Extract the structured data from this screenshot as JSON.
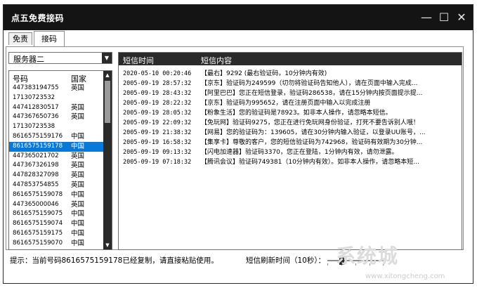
{
  "window": {
    "title": "点五免费接码"
  },
  "titlebar": {
    "minimize_glyph": "—",
    "maximize_glyph": "☐",
    "close_glyph": "✕"
  },
  "tabs": [
    {
      "label": "免责"
    },
    {
      "label": "接码"
    }
  ],
  "server_select": {
    "value": "服务器二"
  },
  "number_list": {
    "headers": {
      "number": "号码",
      "country": "国家"
    },
    "rows": [
      {
        "number": "447383194755",
        "country": "英国"
      },
      {
        "number": "17130723532",
        "country": ""
      },
      {
        "number": "447412830517",
        "country": "英国"
      },
      {
        "number": "447367650736",
        "country": "英国"
      },
      {
        "number": "17130723538",
        "country": ""
      },
      {
        "number": "8616575159176",
        "country": "中国"
      },
      {
        "number": "8616575159178",
        "country": "中国"
      },
      {
        "number": "447365021702",
        "country": "英国"
      },
      {
        "number": "447367326198",
        "country": "英国"
      },
      {
        "number": "447828327098",
        "country": "英国"
      },
      {
        "number": "447853754855",
        "country": "英国"
      },
      {
        "number": "8616575159078",
        "country": "中国"
      },
      {
        "number": "447365000046",
        "country": "英国"
      },
      {
        "number": "8616575159075",
        "country": "中国"
      },
      {
        "number": "8616575159074",
        "country": "中国"
      },
      {
        "number": "8616575159175",
        "country": "中国"
      },
      {
        "number": "8616575159070",
        "country": "中国"
      }
    ],
    "selected_index": 6
  },
  "sms_list": {
    "headers": {
      "time": "短信时间",
      "content": "短信内容"
    },
    "rows": [
      {
        "time": "2020-05-10 00:20:46",
        "content": "【最右】9292 (最右验证码，10分钟内有效)"
      },
      {
        "time": "2005-09-19 28:57:32",
        "content": "【京东】验证码为249599（切勿将验证码告知他人），请在页面中输入完成..."
      },
      {
        "time": "2005-09-19 28:43:32",
        "content": "【阿里巴巴】您正在短信登录，验证码286538，请在15分钟内按页面提示提..."
      },
      {
        "time": "2005-09-19 28:22:32",
        "content": "【京东】验证码为995652，请在注册页面中输入以完成注册"
      },
      {
        "time": "2005-09-19 28:05:32",
        "content": "【粉象生活】您的验证码是78923。如非本人操作，请忽略本短信。"
      },
      {
        "time": "2005-09-19 22:09:32",
        "content": "【免玩网】验证码9275，您正在进行免玩网身份验证，打死不要告诉别人哦！"
      },
      {
        "time": "2005-09-19 21:38:32",
        "content": "【网易】您的验证码为：139605，请在30分钟内输入验证，以登录UU账号，..."
      },
      {
        "time": "2005-09-19 16:58:32",
        "content": "【集享卡】尊敬的客户，您的短信验证码为742968，验证码有效期为30分钟..."
      },
      {
        "time": "2005-09-19 09:13:32",
        "content": "【闪电加速器】验证码3370，您正在登陆，1分钟内有效，请勿泄露。"
      },
      {
        "time": "2005-09-19 07:18:32",
        "content": "【腾讯会议】验证码749381（10分钟内有效）。如非本人操作，请忽略本短..."
      }
    ]
  },
  "status": {
    "message": "提示：当前号码8616575159178已经复制，请直接粘贴使用。",
    "refresh_label": "短信刷新时间（10秒）："
  },
  "watermark": {
    "text": "系统城",
    "url": "www.xitongcheng.com"
  },
  "colors": {
    "titlebar": "#141414",
    "selection": "#0a78d7",
    "header_dark": "#2a2a2a"
  }
}
